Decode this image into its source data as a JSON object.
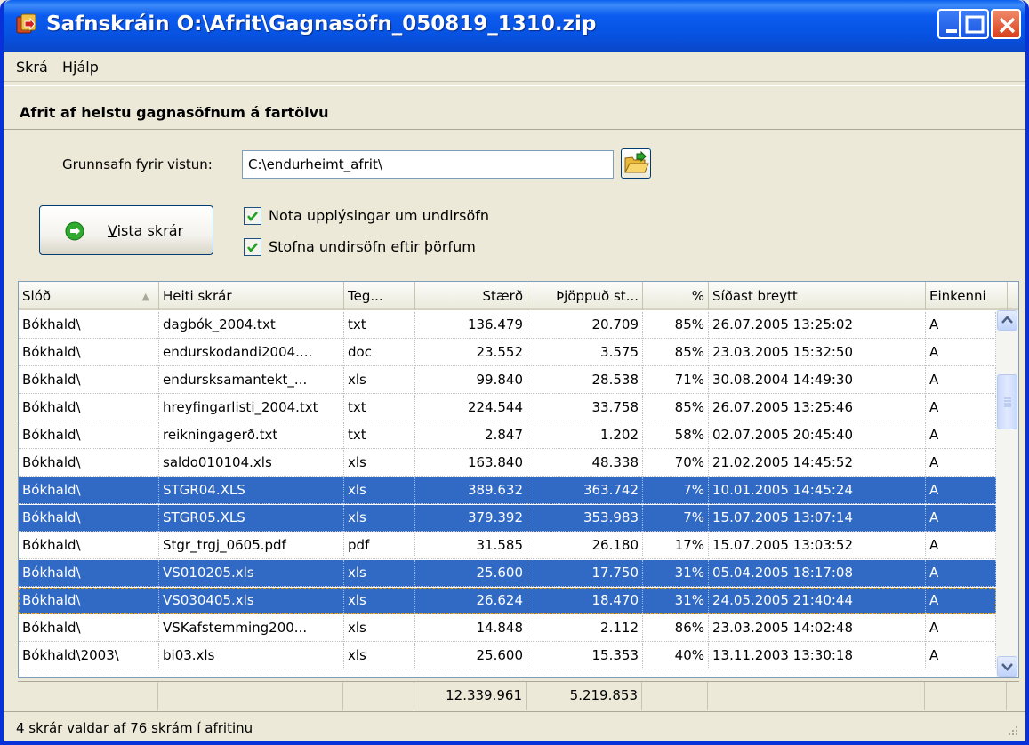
{
  "window": {
    "title": "Safnskráin O:\\Afrit\\Gagnasöfn_050819_1310.zip",
    "app_icon": "archive-icon"
  },
  "menu": {
    "items": [
      "Skrá",
      "Hjálp"
    ]
  },
  "header": {
    "text": "Afrit af helstu gagnasöfnum á fartölvu"
  },
  "form": {
    "grunn_label": "Grunnsafn fyrir vistun:",
    "grunn_value": "C:\\endurheimt_afrit\\",
    "browse_icon": "folder-open-icon",
    "vista_label": "Vista skrár",
    "vista_icon": "arrow-right-circle-icon",
    "check1_label": "Nota upplýsingar um undirsöfn",
    "check1_checked": true,
    "check2_label": "Stofna undirsöfn eftir þörfum",
    "check2_checked": true
  },
  "grid": {
    "columns": [
      "Slóð",
      "Heiti skrár",
      "Teg...",
      "Stærð",
      "Þjöppuð st...",
      "%",
      "Síðast breytt",
      "Einkenni"
    ],
    "rows": [
      {
        "path": "Bókhald\\",
        "name": "dagbók_2004.txt",
        "type": "txt",
        "size": "136.479",
        "comp": "20.709",
        "pct": "85%",
        "date": "26.07.2005 13:25:02",
        "attr": "A",
        "sel": false
      },
      {
        "path": "Bókhald\\",
        "name": "endurskodandi2004....",
        "type": "doc",
        "size": "23.552",
        "comp": "3.575",
        "pct": "85%",
        "date": "23.03.2005 15:32:50",
        "attr": "A",
        "sel": false
      },
      {
        "path": "Bókhald\\",
        "name": "endursksamantekt_...",
        "type": "xls",
        "size": "99.840",
        "comp": "28.538",
        "pct": "71%",
        "date": "30.08.2004 14:49:30",
        "attr": "A",
        "sel": false
      },
      {
        "path": "Bókhald\\",
        "name": "hreyfingarlisti_2004.txt",
        "type": "txt",
        "size": "224.544",
        "comp": "33.758",
        "pct": "85%",
        "date": "26.07.2005 13:25:46",
        "attr": "A",
        "sel": false
      },
      {
        "path": "Bókhald\\",
        "name": "reikningagerð.txt",
        "type": "txt",
        "size": "2.847",
        "comp": "1.202",
        "pct": "58%",
        "date": "02.07.2005 20:45:40",
        "attr": "A",
        "sel": false
      },
      {
        "path": "Bókhald\\",
        "name": "saldo010104.xls",
        "type": "xls",
        "size": "163.840",
        "comp": "48.338",
        "pct": "70%",
        "date": "21.02.2005 14:45:52",
        "attr": "A",
        "sel": false
      },
      {
        "path": "Bókhald\\",
        "name": "STGR04.XLS",
        "type": "xls",
        "size": "389.632",
        "comp": "363.742",
        "pct": "7%",
        "date": "10.01.2005 14:45:24",
        "attr": "A",
        "sel": true
      },
      {
        "path": "Bókhald\\",
        "name": "STGR05.XLS",
        "type": "xls",
        "size": "379.392",
        "comp": "353.983",
        "pct": "7%",
        "date": "15.07.2005 13:07:14",
        "attr": "A",
        "sel": true
      },
      {
        "path": "Bókhald\\",
        "name": "Stgr_trgj_0605.pdf",
        "type": "pdf",
        "size": "31.585",
        "comp": "26.180",
        "pct": "17%",
        "date": "15.07.2005 13:03:52",
        "attr": "A",
        "sel": false
      },
      {
        "path": "Bókhald\\",
        "name": "VS010205.xls",
        "type": "xls",
        "size": "25.600",
        "comp": "17.750",
        "pct": "31%",
        "date": "05.04.2005 18:17:08",
        "attr": "A",
        "sel": true
      },
      {
        "path": "Bókhald\\",
        "name": "VS030405.xls",
        "type": "xls",
        "size": "26.624",
        "comp": "18.470",
        "pct": "31%",
        "date": "24.05.2005 21:40:44",
        "attr": "A",
        "sel": true,
        "focus": true
      },
      {
        "path": "Bókhald\\",
        "name": "VSKafstemming200...",
        "type": "xls",
        "size": "14.848",
        "comp": "2.112",
        "pct": "86%",
        "date": "23.03.2005 14:02:48",
        "attr": "A",
        "sel": false
      },
      {
        "path": "Bókhald\\2003\\",
        "name": "bi03.xls",
        "type": "xls",
        "size": "25.600",
        "comp": "15.353",
        "pct": "40%",
        "date": "13.11.2003 13:30:18",
        "attr": "A",
        "sel": false
      }
    ],
    "totals": {
      "size": "12.339.961",
      "comp": "5.219.853"
    }
  },
  "status": {
    "text": "4 skrár valdar af 76  skrám í afritinu"
  },
  "colors": {
    "selection": "#316ac5",
    "titlebar": "#0752e0",
    "face": "#ece9d8"
  }
}
